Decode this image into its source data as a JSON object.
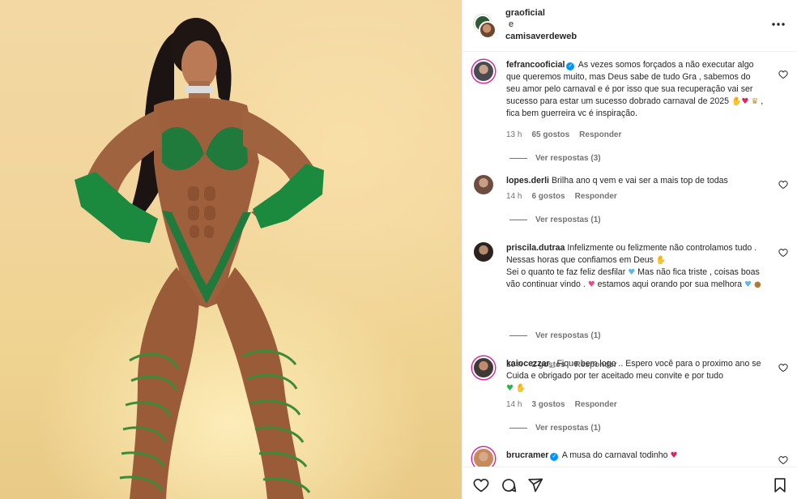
{
  "header": {
    "user1": "graoficial",
    "connector": "e",
    "user2": "camisaverdeweb",
    "more_icon": "more-horizontal-icon"
  },
  "comments": [
    {
      "user": "fefrancooficial",
      "verified": true,
      "text": "As vezes somos forçados a não executar algo que queremos muito, mas Deus sabe de tudo Gra , sabemos do seu amor pelo carnaval e é por isso que sua recuperação vai ser sucesso para estar um sucesso dobrado carnaval de 2025",
      "text_tail": ", fica bem guerreira vc é inspiração.",
      "time": "13 h",
      "likes": "65 gostos",
      "reply": "Responder",
      "view_replies": "Ver respostas (3)"
    },
    {
      "user": "lopes.derli",
      "verified": false,
      "text": "Brilha ano q vem e vai ser a mais top de todas",
      "time": "14 h",
      "likes": "6 gostos",
      "reply": "Responder",
      "view_replies": "Ver respostas (1)"
    },
    {
      "user": "priscila.dutraa",
      "verified": false,
      "text_line1": "Infelizmente ou felizmente não controlamos tudo . Nessas horas que confiamos em Deus",
      "text_line2": "Sei o quanto te faz feliz desfilar",
      "text_line2b": "Mas não fica triste , coisas boas vão continuar vindo .",
      "text_line2c": "estamos aqui orando por sua melhora",
      "time": "10 h",
      "likes": "2 gostos",
      "reply": "Responder",
      "view_replies": "Ver respostas (1)"
    },
    {
      "user": "kaiocezzar_",
      "verified": false,
      "text": "Fique bem logo .. Espero você para o proximo ano se Cuida e obrigado por ter aceitado meu convite e por tudo",
      "time": "14 h",
      "likes": "3 gostos",
      "reply": "Responder",
      "view_replies": "Ver respostas (1)"
    },
    {
      "user": "brucramer",
      "verified": true,
      "text": "A musa do carnaval todinho"
    }
  ],
  "actions": {
    "like_icon": "heart-icon",
    "comment_icon": "comment-icon",
    "share_icon": "send-icon",
    "save_icon": "bookmark-icon"
  },
  "colors": {
    "verified": "#0095f6",
    "text": "#262626",
    "muted": "#737373",
    "background": "#efd391"
  }
}
